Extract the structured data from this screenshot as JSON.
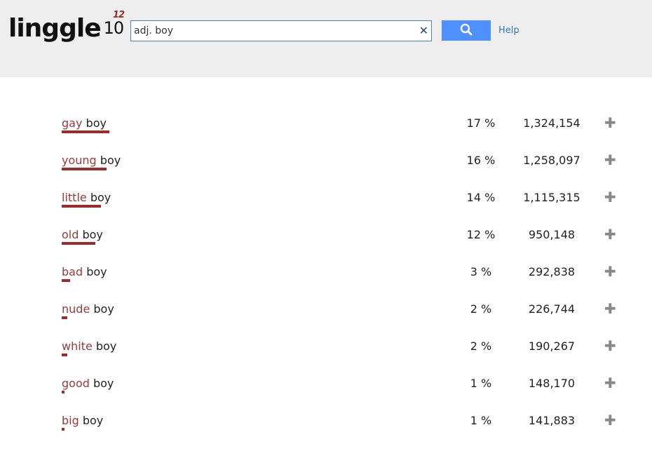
{
  "header": {
    "logo": "linggle",
    "logo_version": "10",
    "logo_exponent": "12",
    "search_value": "adj. boy",
    "help_label": "Help",
    "clear_icon": "close-icon",
    "search_icon": "search-icon"
  },
  "accent_color": "#9b2c2c",
  "results": [
    {
      "word": "gay",
      "rest": "boy",
      "percent": "17 %",
      "percent_value": 17,
      "count": "1,324,154"
    },
    {
      "word": "young",
      "rest": "boy",
      "percent": "16 %",
      "percent_value": 16,
      "count": "1,258,097"
    },
    {
      "word": "little",
      "rest": "boy",
      "percent": "14 %",
      "percent_value": 14,
      "count": "1,115,315"
    },
    {
      "word": "old",
      "rest": "boy",
      "percent": "12 %",
      "percent_value": 12,
      "count": "950,148"
    },
    {
      "word": "bad",
      "rest": "boy",
      "percent": "3 %",
      "percent_value": 3,
      "count": "292,838"
    },
    {
      "word": "nude",
      "rest": "boy",
      "percent": "2 %",
      "percent_value": 2,
      "count": "226,744"
    },
    {
      "word": "white",
      "rest": "boy",
      "percent": "2 %",
      "percent_value": 2,
      "count": "190,267"
    },
    {
      "word": "good",
      "rest": "boy",
      "percent": "1 %",
      "percent_value": 1,
      "count": "148,170"
    },
    {
      "word": "big",
      "rest": "boy",
      "percent": "1 %",
      "percent_value": 1,
      "count": "141,883"
    }
  ]
}
